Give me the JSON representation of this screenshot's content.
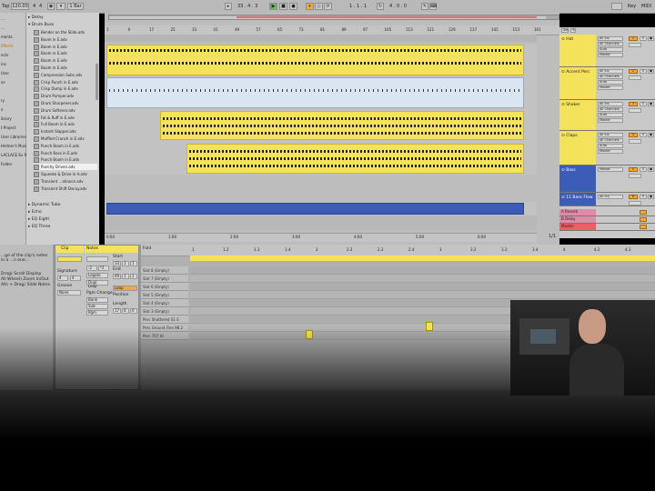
{
  "transport": {
    "tempo": "120.00",
    "signature_num": "4",
    "signature_den": "4",
    "quantize": "1 Bar",
    "position": "33 . 4 . 3",
    "loop_start": "1 . 1 . 1",
    "loop_length": "4 . 0 . 0",
    "key_label": "Key",
    "midi_label": "MIDI"
  },
  "browser": {
    "left_labels": [
      "…",
      "…",
      "ments",
      "Effects",
      "ects",
      "ins",
      "User",
      "es",
      "",
      "ry",
      "e",
      "ibrary",
      "t Project",
      "User Libraries",
      "Helmer's Music",
      "LACLACE Ex 9 (Lar",
      "Folder"
    ],
    "folders": [
      "Delay",
      "Drum Buss"
    ],
    "files": [
      "Bender on the Slide.adv",
      "Boom in E.adv",
      "Boom in E.adv",
      "Boom in E.adv",
      "Boom in E.adv",
      "Boom in E.adv",
      "Compression Subs.adv",
      "Crisp Punch in E.adv",
      "Crisp Dump in E.adv",
      "Drum Pumper.adv",
      "Drum Sharpener.adv",
      "Drum Softener.adv",
      "Fat & Ruff in E.adv",
      "Full Boom in E.adv",
      "Instant Slapper.adv",
      "Muffled Crunch in E.adv",
      "Punch Boom in E.adv",
      "Punch Bass in E.adv",
      "Punch Boom in E.adv",
      "Punchy Driven.adv",
      "Squeeze & Drive in A.adv",
      "Transient ...ahance.adv",
      "Transient Shift Decay.adv"
    ],
    "bottom_folders": [
      "Dynamic Tube",
      "Echo",
      "EQ Eight",
      "EQ Three"
    ],
    "selected_index": 19
  },
  "arrangement": {
    "ruler": [
      "1",
      "9",
      "17",
      "25",
      "33",
      "41",
      "49",
      "57",
      "65",
      "73",
      "81",
      "89",
      "97",
      "105",
      "113",
      "121",
      "129",
      "137",
      "145",
      "153",
      "161"
    ],
    "time_ruler": [
      "0:00",
      "1:00",
      "2:00",
      "3:00",
      "4:00",
      "5:00",
      "6:00"
    ],
    "zoom_label": "1/1"
  },
  "tracks": [
    {
      "name": "Hat",
      "input": "All Ins",
      "channel": "All Channels",
      "monitor": "Auto",
      "out": "Master",
      "num": "1",
      "color": "#f4e35a"
    },
    {
      "name": "Accent Perc",
      "input": "All Ins",
      "channel": "All Channels",
      "monitor": "Auto",
      "out": "Master",
      "num": "2",
      "color": "#f4e35a"
    },
    {
      "name": "Shaker",
      "input": "All Ins",
      "channel": "All Channels",
      "monitor": "Auto",
      "out": "Master",
      "num": "3",
      "color": "#f4e35a"
    },
    {
      "name": "Claps",
      "input": "All Ins",
      "channel": "All Channels",
      "monitor": "Auto",
      "out": "Master",
      "num": "4",
      "color": "#f4e35a"
    },
    {
      "name": "Bass",
      "input": "Master",
      "channel": "",
      "monitor": "",
      "out": "",
      "num": "5",
      "color": "#3d5cb8"
    },
    {
      "name": "11 Bass Flow",
      "input": "All Ins",
      "channel": "",
      "monitor": "",
      "out": "",
      "num": "6",
      "color": "#3d5cb8"
    }
  ],
  "returns": [
    {
      "name": "A Reverb",
      "color": "#e08aa8"
    },
    {
      "name": "B Delay",
      "color": "#e08aa8"
    },
    {
      "name": "Master",
      "color": "#e86060"
    }
  ],
  "info_text": "...ge of the clip's notes in a ...n one...",
  "info_lines": [
    "Drag) Scroll Display",
    "All Wheel) Zoom In/Out",
    "Alt) + Drag) Slide Notes"
  ],
  "clip_panel": {
    "tab_clip": "Clip",
    "tab_notes": "Notes",
    "signature_label": "Signature",
    "sig_num": "4",
    "sig_den": "4",
    "groove_label": "Groove",
    "groove_value": "None",
    "start_label": "Start",
    "end_label": "End",
    "loop_label": "Loop",
    "pgm_label": "Pgm Change",
    "length_label": "Length",
    "bank_label": "Bank",
    "sub_label": "Sub",
    "pgm_value": "Pgm",
    "legato_label": "Legato",
    "dupl_label": "Dupl. Loop",
    "fold_label": "Fold",
    "vals": [
      "33",
      "1",
      "1",
      "49",
      "1",
      "1",
      "17",
      "0",
      "0"
    ]
  },
  "midi": {
    "ruler": [
      "1",
      "1.2",
      "1.3",
      "1.4",
      "2",
      "2.2",
      "2.3",
      "2.4",
      "3",
      "3.2",
      "3.3",
      "3.4",
      "4",
      "4.2",
      "4.3",
      "4.4"
    ],
    "rows": [
      "Slot 8 (Empty)",
      "Slot 7 (Empty)",
      "Slot 6 (Empty)",
      "Slot 5 (Empty)",
      "Slot 4 (Empty)",
      "Slot 3 (Empty)",
      "Perc Shattered S1 S",
      "Perc Ground Fine 98 2",
      "Perc 707 Hi"
    ]
  }
}
